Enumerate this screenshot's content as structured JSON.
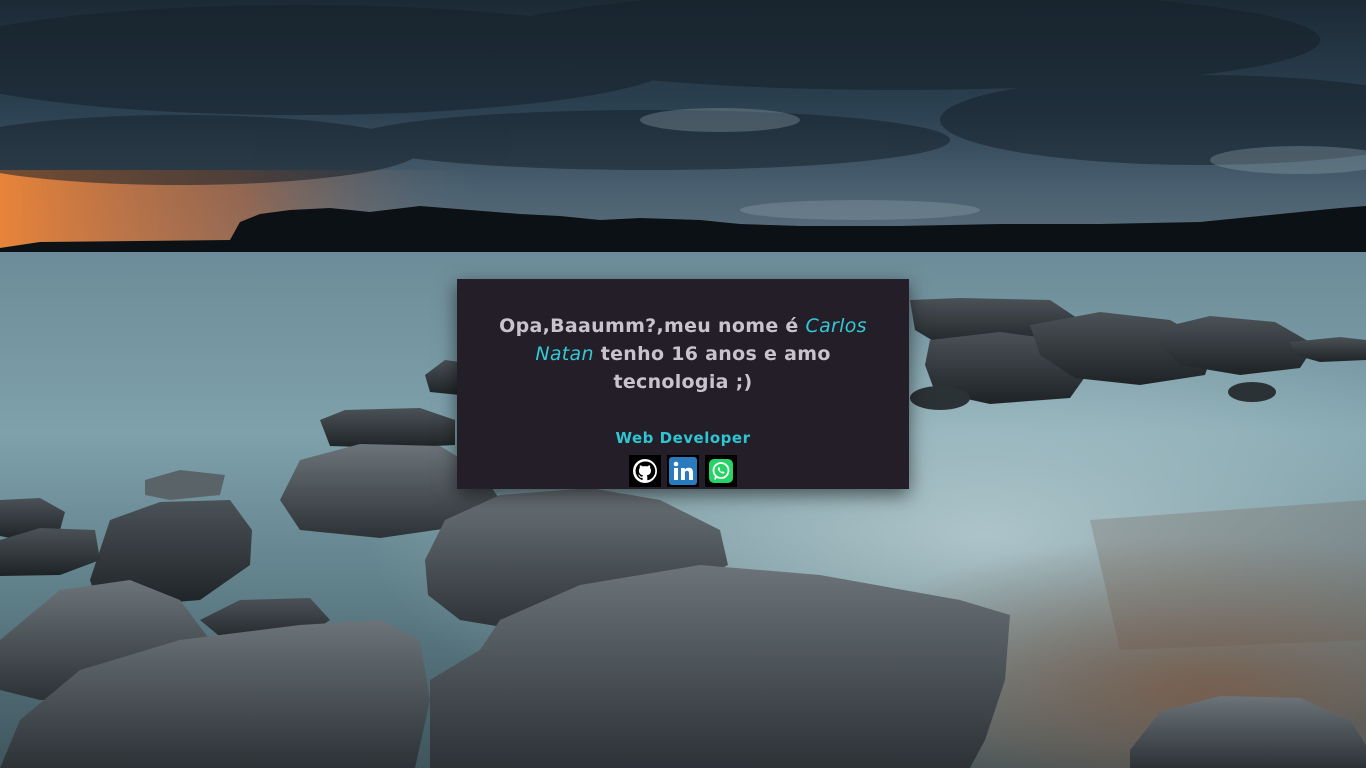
{
  "card": {
    "greeting": "Opa,Baaumm?,meu nome é ",
    "name": "Carlos Natan",
    "rest": " tenho 16 anos e amo tecnologia ;)",
    "role": "Web Developer"
  },
  "socials": [
    {
      "icon": "github-icon",
      "color": "#000000"
    },
    {
      "icon": "linkedin-icon",
      "color": "#2a7bbd"
    },
    {
      "icon": "whatsapp-icon",
      "color": "#25d366"
    }
  ],
  "colors": {
    "card_bg": "#231e27",
    "accent": "#35c9d6",
    "text": "#c9c4cc"
  }
}
